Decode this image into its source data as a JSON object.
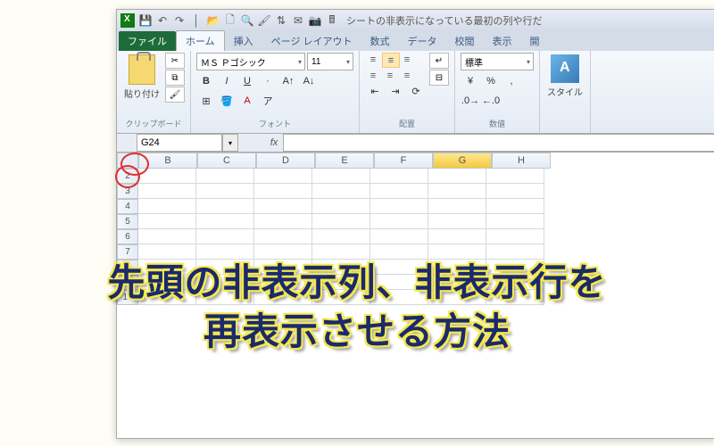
{
  "titlebar": {
    "text": "シートの非表示になっている最初の列や行だ"
  },
  "tabs": {
    "file": "ファイル",
    "home": "ホーム",
    "insert": "挿入",
    "layout": "ページ レイアウト",
    "formulas": "数式",
    "data": "データ",
    "review": "校閲",
    "view": "表示",
    "dev": "開"
  },
  "clipboard": {
    "paste": "貼り付け",
    "group": "クリップボード"
  },
  "font": {
    "name": "ＭＳ Ｐゴシック",
    "size": "11",
    "group": "フォント"
  },
  "align": {
    "group": "配置"
  },
  "number": {
    "format": "標準",
    "group": "数値"
  },
  "styles": {
    "label": "スタイル"
  },
  "namebox": {
    "ref": "G24",
    "fx": "fx"
  },
  "columns": [
    "B",
    "C",
    "D",
    "E",
    "F",
    "G",
    "H"
  ],
  "sel_col": "G",
  "rows": [
    "2",
    "3",
    "4",
    "5",
    "6",
    "7",
    "8",
    "9",
    "10"
  ],
  "overlay": {
    "l1": "先頭の非表示列、非表示行を",
    "l2": "再表示させる方法"
  }
}
